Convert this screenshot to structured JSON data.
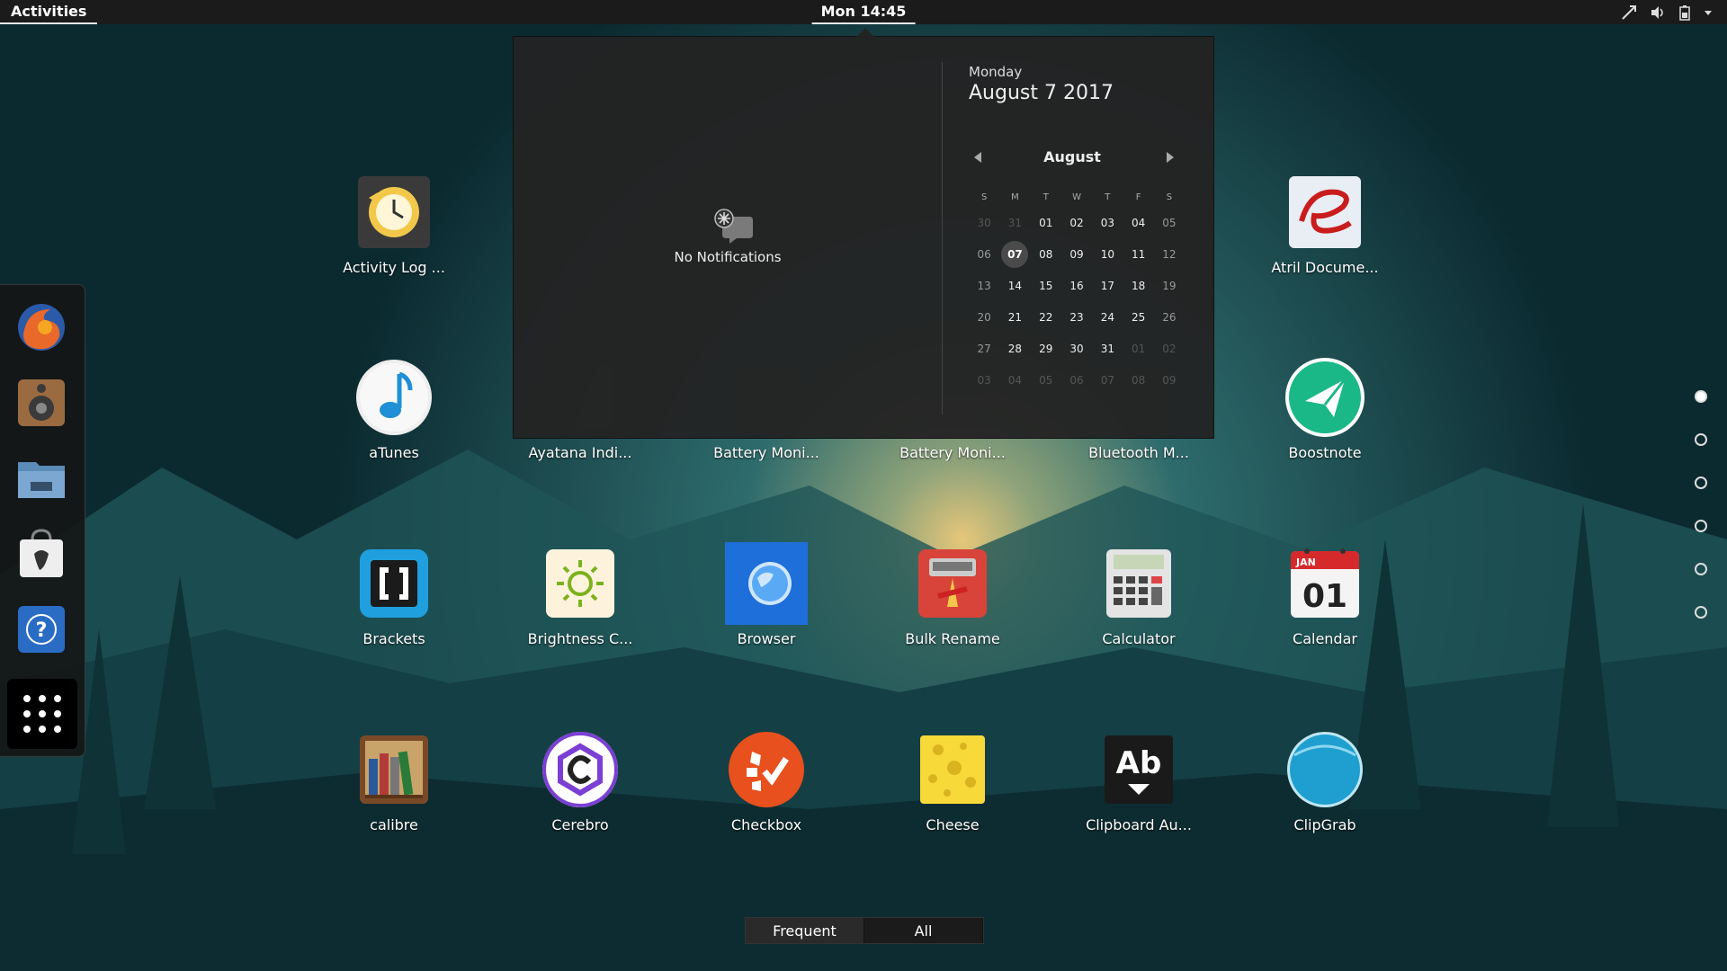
{
  "topbar": {
    "activities_label": "Activities",
    "clock": "Mon 14:45",
    "tray_icons": [
      "network-icon",
      "volume-icon",
      "battery-icon",
      "dropdown-arrow-icon"
    ]
  },
  "popup": {
    "notifications_empty": "No Notifications",
    "calendar": {
      "weekday": "Monday",
      "date": "August  7 2017",
      "month": "August",
      "weekday_headers": [
        "S",
        "M",
        "T",
        "W",
        "T",
        "F",
        "S"
      ],
      "weeks": [
        [
          "30",
          "31",
          "01",
          "02",
          "03",
          "04",
          "05"
        ],
        [
          "06",
          "07",
          "08",
          "09",
          "10",
          "11",
          "12"
        ],
        [
          "13",
          "14",
          "15",
          "16",
          "17",
          "18",
          "19"
        ],
        [
          "20",
          "21",
          "22",
          "23",
          "24",
          "25",
          "26"
        ],
        [
          "27",
          "28",
          "29",
          "30",
          "31",
          "01",
          "02"
        ],
        [
          "03",
          "04",
          "05",
          "06",
          "07",
          "08",
          "09"
        ]
      ],
      "today": "07"
    }
  },
  "dash": {
    "items": [
      "firefox-icon",
      "speaker-icon",
      "files-icon",
      "software-store-icon",
      "help-icon",
      "app-grid-icon"
    ]
  },
  "apps": [
    {
      "label": "Activity Log ...",
      "icon": "activity-log-icon"
    },
    {
      "label": "Atril Docume...",
      "icon": "atril-icon"
    },
    {
      "label": "aTunes",
      "icon": "atunes-icon"
    },
    {
      "label": "Ayatana Indi...",
      "icon": "ayatana-icon"
    },
    {
      "label": "Battery Moni...",
      "icon": "battery-monitor-icon"
    },
    {
      "label": "Battery Moni...",
      "icon": "battery-monitor-icon"
    },
    {
      "label": "Bluetooth M...",
      "icon": "bluetooth-icon"
    },
    {
      "label": "Boostnote",
      "icon": "boostnote-icon"
    },
    {
      "label": "Brackets",
      "icon": "brackets-icon"
    },
    {
      "label": "Brightness C...",
      "icon": "brightness-icon"
    },
    {
      "label": "Browser",
      "icon": "browser-icon"
    },
    {
      "label": "Bulk Rename",
      "icon": "bulk-rename-icon"
    },
    {
      "label": "Calculator",
      "icon": "calculator-icon"
    },
    {
      "label": "Calendar",
      "icon": "calendar-icon"
    },
    {
      "label": "calibre",
      "icon": "calibre-icon"
    },
    {
      "label": "Cerebro",
      "icon": "cerebro-icon"
    },
    {
      "label": "Checkbox",
      "icon": "checkbox-icon"
    },
    {
      "label": "Cheese",
      "icon": "cheese-icon"
    },
    {
      "label": "Clipboard Au...",
      "icon": "clipboard-icon"
    },
    {
      "label": "ClipGrab",
      "icon": "clipgrab-icon"
    }
  ],
  "calendar_icon_text": {
    "month": "JAN",
    "day": "01"
  },
  "clipboard_icon_text": "Ab",
  "pages": {
    "count": 6,
    "current": 1
  },
  "switcher": {
    "frequent": "Frequent",
    "all": "All"
  }
}
